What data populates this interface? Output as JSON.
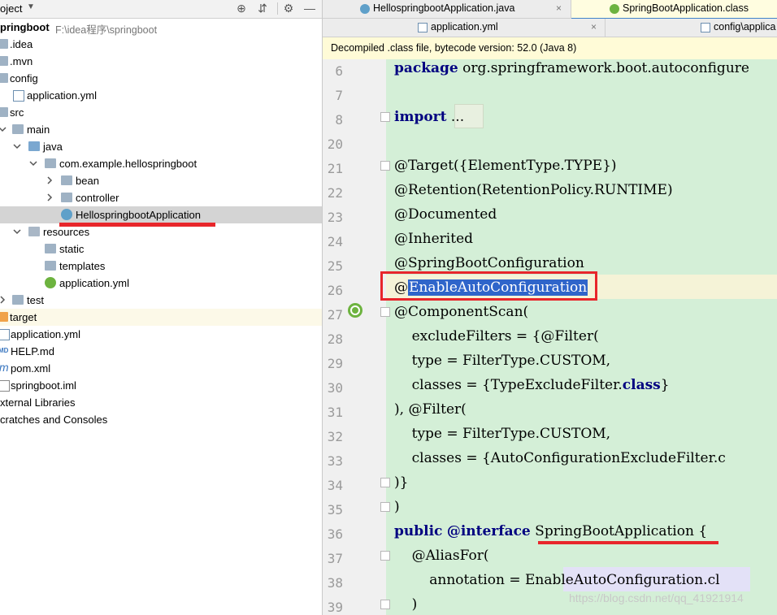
{
  "project": {
    "header": {
      "title": "oject",
      "caret": "▼",
      "icons": [
        "target-icon",
        "collapse-icon",
        "gear-icon",
        "hide-icon"
      ]
    },
    "root": {
      "name": "pringboot",
      "path": "F:\\idea程序\\springboot"
    },
    "items": [
      {
        "label": ".idea"
      },
      {
        "label": ".mvn"
      },
      {
        "label": "config"
      },
      {
        "label": "application.yml"
      },
      {
        "label": "src"
      },
      {
        "label": "main"
      },
      {
        "label": "java"
      },
      {
        "label": "com.example.hellospringboot"
      },
      {
        "label": "bean"
      },
      {
        "label": "controller"
      },
      {
        "label": "HellospringbootApplication"
      },
      {
        "label": "resources"
      },
      {
        "label": "static"
      },
      {
        "label": "templates"
      },
      {
        "label": "application.yml"
      },
      {
        "label": "test"
      },
      {
        "label": "target"
      },
      {
        "label": "application.yml"
      },
      {
        "label": "HELP.md"
      },
      {
        "label": "pom.xml"
      },
      {
        "label": "springboot.iml"
      },
      {
        "label": "xternal Libraries"
      },
      {
        "label": "cratches and Consoles"
      }
    ]
  },
  "editor": {
    "tabs_row1": [
      {
        "label": "HellospringbootApplication.java",
        "close": "×"
      },
      {
        "label": "SpringBootApplication.class",
        "active": true
      }
    ],
    "tabs_row2": [
      {
        "label": "application.yml",
        "close": "×"
      },
      {
        "label": "config\\applica"
      }
    ],
    "banner": "Decompiled .class file, bytecode version: 52.0 (Java 8)",
    "lines": [
      {
        "n": "6",
        "text": "package org.springframework.boot.autoconfigure"
      },
      {
        "n": "7",
        "text": ""
      },
      {
        "n": "8",
        "text": "import ..."
      },
      {
        "n": "20",
        "text": ""
      },
      {
        "n": "21",
        "text": "@Target({ElementType.TYPE})"
      },
      {
        "n": "22",
        "text": "@Retention(RetentionPolicy.RUNTIME)"
      },
      {
        "n": "23",
        "text": "@Documented"
      },
      {
        "n": "24",
        "text": "@Inherited"
      },
      {
        "n": "25",
        "text": "@SpringBootConfiguration"
      },
      {
        "n": "26",
        "text": "@EnableAutoConfiguration"
      },
      {
        "n": "27",
        "text": "@ComponentScan("
      },
      {
        "n": "28",
        "text": "    excludeFilters = {@Filter("
      },
      {
        "n": "29",
        "text": "    type = FilterType.CUSTOM,"
      },
      {
        "n": "30",
        "text": "    classes = {TypeExcludeFilter.class}"
      },
      {
        "n": "31",
        "text": "), @Filter("
      },
      {
        "n": "32",
        "text": "    type = FilterType.CUSTOM,"
      },
      {
        "n": "33",
        "text": "    classes = {AutoConfigurationExcludeFilter.c"
      },
      {
        "n": "34",
        "text": ")}"
      },
      {
        "n": "35",
        "text": ")"
      },
      {
        "n": "36",
        "text": "public @interface SpringBootApplication {"
      },
      {
        "n": "37",
        "text": "    @AliasFor("
      },
      {
        "n": "38",
        "text": "        annotation = EnableAutoConfiguration.cl"
      },
      {
        "n": "39",
        "text": "    )"
      }
    ]
  },
  "watermark": "https://blog.csdn.net/qq_41921914",
  "colors": {
    "highlight_red": "#e8262b",
    "code_bg": "#d4efd7",
    "keyword": "#000080",
    "selection": "#2f65ca"
  }
}
